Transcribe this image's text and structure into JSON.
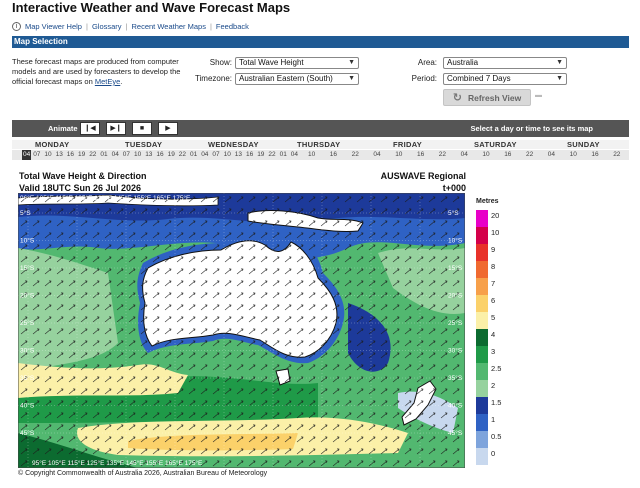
{
  "page": {
    "title": "Interactive Weather and Wave Forecast Maps",
    "links": [
      "Map Viewer Help",
      "Glossary",
      "Recent Weather Maps",
      "Feedback"
    ],
    "section_title": "Map Selection",
    "intro_text": "These forecast maps are produced from computer models and are used by forecasters to develop the official forecast maps on",
    "intro_link": "MetEye"
  },
  "controls": {
    "show_label": "Show:",
    "show_value": "Total Wave Height",
    "timezone_label": "Timezone:",
    "timezone_value": "Australian Eastern (South)",
    "area_label": "Area:",
    "area_value": "Australia",
    "period_label": "Period:",
    "period_value": "Combined 7 Days",
    "refresh_label": "Refresh View",
    "refresh_tail": "▬"
  },
  "animation": {
    "label": "Animate",
    "buttons": [
      "❙◀",
      "▶❙",
      "■",
      "▶"
    ],
    "hint": "Select a day or time to see its map"
  },
  "days": [
    "MONDAY",
    "TUESDAY",
    "WEDNESDAY",
    "THURSDAY",
    "FRIDAY",
    "SATURDAY",
    "SUNDAY"
  ],
  "hours_dense": [
    "04",
    "07",
    "10",
    "13",
    "16",
    "19",
    "22",
    "01",
    "04",
    "07",
    "10",
    "13",
    "16",
    "19",
    "22",
    "01",
    "04",
    "07",
    "10",
    "13",
    "16",
    "19",
    "22",
    "01",
    "04"
  ],
  "hours_sparse": [
    "10",
    "16",
    "22",
    "04",
    "10",
    "16",
    "22",
    "04",
    "10",
    "16",
    "22",
    "04",
    "10",
    "16",
    "22"
  ],
  "selected_hour": "04",
  "map": {
    "title_line1": "Total Wave Height & Direction",
    "title_line2": "Valid 18UTC Sun 26 Jul 2026",
    "model": "AUSWAVE Regional",
    "lead": "t+000",
    "lon_top": "96°E 105°E 115°E 125°E 135°E 145°E 155°E 165°E 175°E",
    "lon_bottom": "95°E 105°E 115°E 125°E 135°E 145°E 155°E 165°E 175°E",
    "lat_labels": [
      "5°S",
      "10°S",
      "15°S",
      "20°S",
      "25°S",
      "30°S",
      "35°S",
      "40°S",
      "45°S"
    ],
    "copyright": "© Copyright Commonwealth of Australia 2026, Australian Bureau of Meteorology"
  },
  "legend": {
    "title": "Metres",
    "levels": [
      {
        "label": "20",
        "color": "#e800c8"
      },
      {
        "label": "10",
        "color": "#d4004a"
      },
      {
        "label": "9",
        "color": "#e8322a"
      },
      {
        "label": "8",
        "color": "#f06a30"
      },
      {
        "label": "7",
        "color": "#f7a04a"
      },
      {
        "label": "6",
        "color": "#fbd16a"
      },
      {
        "label": "5",
        "color": "#fbf0a8"
      },
      {
        "label": "4",
        "color": "#0c6b30"
      },
      {
        "label": "3",
        "color": "#1f9a48"
      },
      {
        "label": "2.5",
        "color": "#52b870"
      },
      {
        "label": "2",
        "color": "#96d29e"
      },
      {
        "label": "1.5",
        "color": "#1d3a9a"
      },
      {
        "label": "1",
        "color": "#2f62c4"
      },
      {
        "label": "0.5",
        "color": "#7ea4dc"
      },
      {
        "label": "0",
        "color": "#c8d8ee"
      }
    ]
  },
  "colors": {
    "accent_bar": "#1f5a94",
    "link": "#1a4a8a",
    "land": "#ffffff"
  }
}
